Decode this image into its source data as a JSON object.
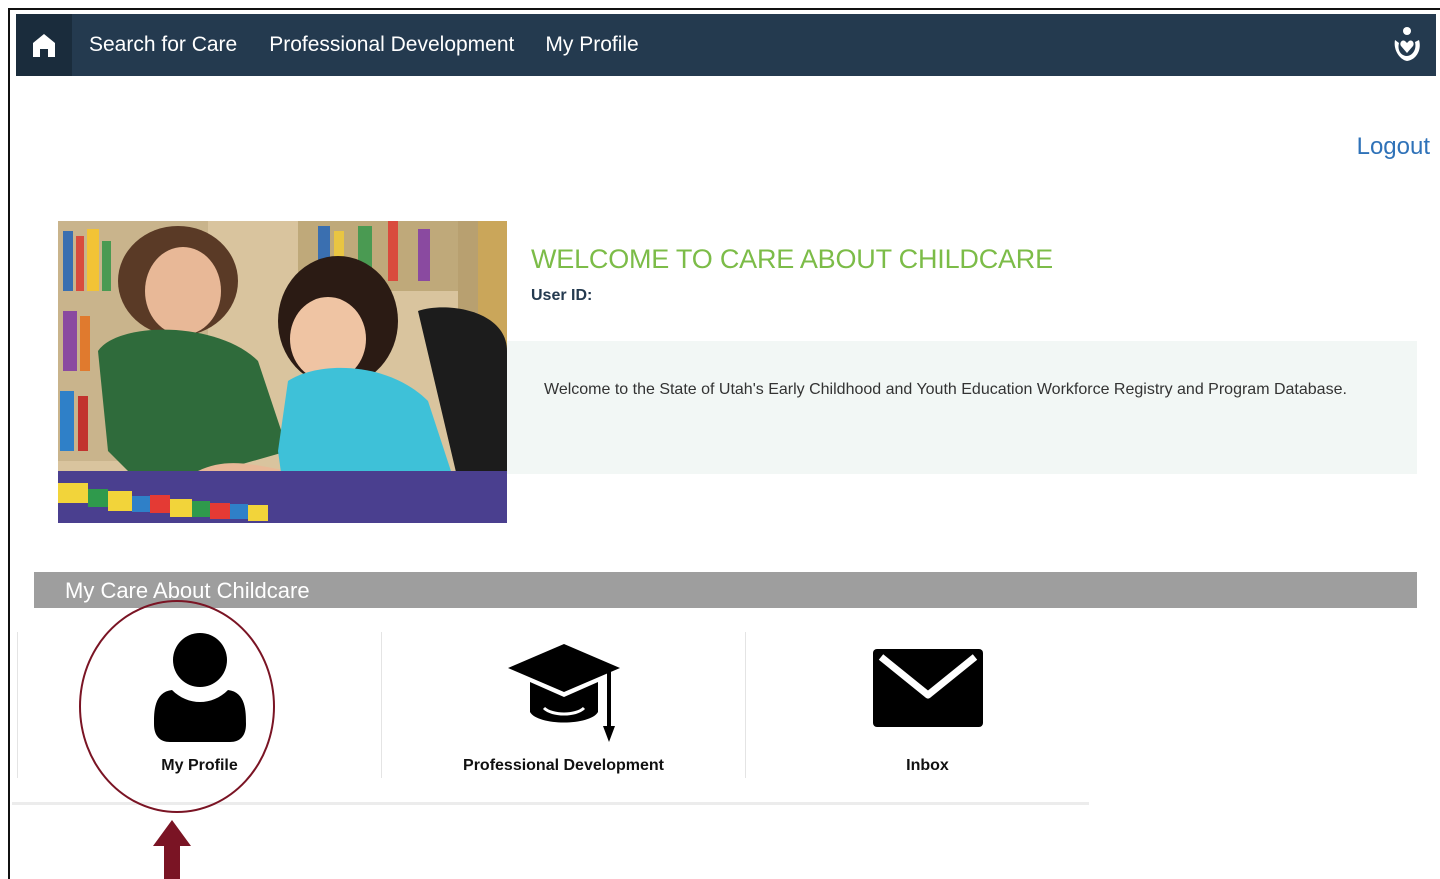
{
  "nav": {
    "home_icon": "home-icon",
    "items": [
      {
        "label": "Search for Care"
      },
      {
        "label": "Professional Development"
      },
      {
        "label": "My Profile"
      }
    ],
    "brand_icon": "care-about-childcare-logo-icon",
    "bg_color": "#243a4f"
  },
  "header": {
    "logout_label": "Logout"
  },
  "welcome": {
    "title": "WELCOME TO CARE ABOUT CHILDCARE",
    "user_id_label": "User ID:",
    "message": "Welcome to the State of Utah's Early Childhood and Youth Education Workforce Registry and Program Database.",
    "title_color": "#7cbc48"
  },
  "section": {
    "title": "My Care About Childcare"
  },
  "tiles": [
    {
      "label": "My Profile",
      "icon": "user-icon"
    },
    {
      "label": "Professional Development",
      "icon": "graduation-cap-icon"
    },
    {
      "label": "Inbox",
      "icon": "envelope-icon"
    }
  ],
  "annotation": {
    "color": "#7a1424",
    "shapes": [
      "circle",
      "up-arrow"
    ]
  }
}
